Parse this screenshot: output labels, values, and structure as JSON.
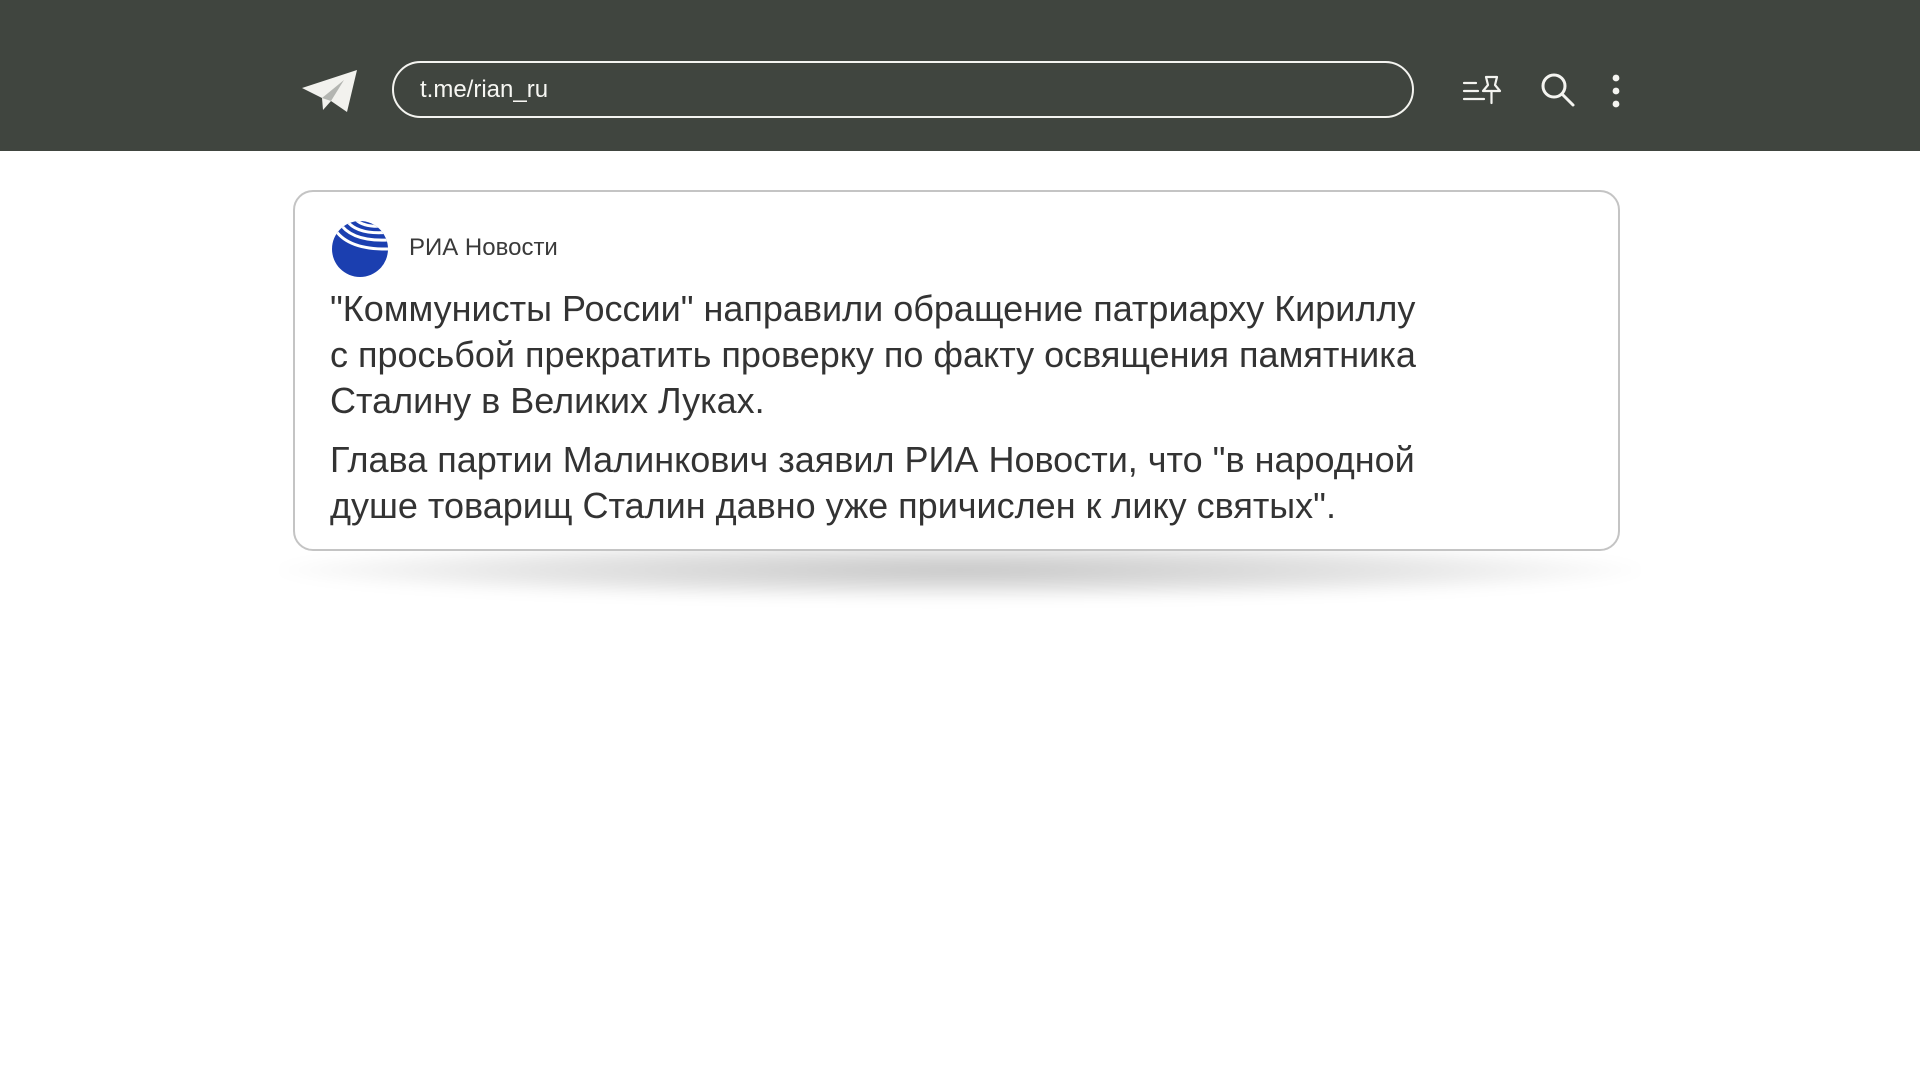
{
  "topbar": {
    "app_icon": "telegram-icon",
    "url": "t.me/rian_ru",
    "icons": [
      "pinned-list-icon",
      "search-icon",
      "more-vertical-icon"
    ]
  },
  "post": {
    "avatar_icon": "ria-novosti-globe-icon",
    "channel_name": "РИА Новости",
    "paragraph1": "\"Коммунисты России\" направили обращение патриарху Кириллу\nс просьбой  прекратить проверку по факту освящения памятника\nСталину в Великих Луках.",
    "paragraph2": "Глава партии Малинкович заявил РИА Новости, что \"в народной\nдуше товарищ Сталин давно уже причислен к лику святых\"."
  },
  "colors": {
    "topbar_bg": "#40453f",
    "topbar_fg": "#f4f4f0",
    "card_border": "#c4c4c4",
    "text": "#333333",
    "avatar_blue": "#1b3fb0"
  }
}
